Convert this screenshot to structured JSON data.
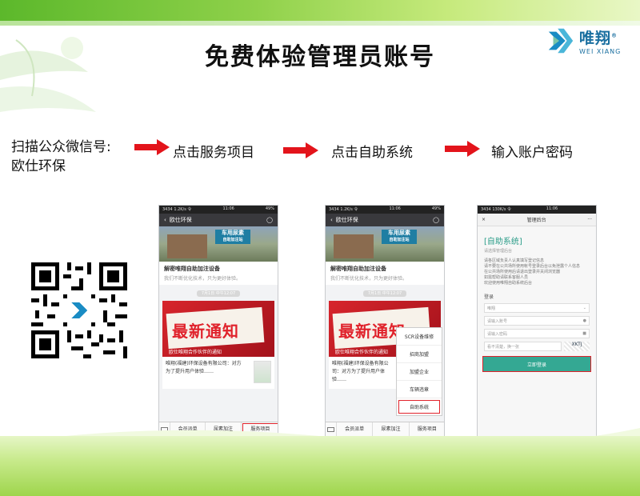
{
  "title": "免费体验管理员账号",
  "logo": {
    "cn": "唯翔",
    "reg": "®",
    "en": "WEI XIANG"
  },
  "steps": {
    "step1_line1": "扫描公众微信号:",
    "step1_line2": "欧仕环保",
    "step2": "点击服务项目",
    "step3": "点击自助系统",
    "step4": "输入账户密码"
  },
  "colors": {
    "arrow": "#e3141b",
    "green": "#5cb82b",
    "login_btn": "#34a893"
  },
  "phone1": {
    "status_left": "3434 1.2K/s 令",
    "status_time": "11:06",
    "status_right": "49%",
    "nav_title": "欧仕环保",
    "sign": "车用尿素",
    "sign_sub": "自助加注站",
    "article_title": "解密唯翔自助加注设备",
    "article_sub": "我们不断优化技术，只为更好体验。",
    "date": "7月1日 中午12:07",
    "notice_big": "最新通知",
    "notice_caption": "欧仕唯翔合作伙伴的通知",
    "notice_text": "唯翔(福建)环保设备有限公司：对方为了提升用户体验……",
    "menu": [
      "会员派单",
      "尿素加注",
      "服务项目"
    ]
  },
  "phone2": {
    "status_left": "3434 1.2K/s 令",
    "status_time": "11:06",
    "status_right": "49%",
    "nav_title": "欧仕环保",
    "sign": "车用尿素",
    "sign_sub": "自助加注站",
    "article_title": "解密唯翔自助加注设备",
    "article_sub": "我们不断优化技术，只为更好体验。",
    "date": "7月1日 中午12:07",
    "notice_big": "最新通知",
    "notice_caption": "欧仕唯翔合作伙伴的通知",
    "notice_text": "唯翔(福建)环保设备有限公司：对方为了提升用户体验……",
    "popup": [
      "SCR设备维修",
      "招商加盟",
      "加盟企业",
      "车辆违章",
      "自助系统"
    ],
    "menu": [
      "会员派单",
      "尿素加注",
      "服务项目"
    ]
  },
  "phone3": {
    "status_left": "3434 130K/s 令",
    "status_time": "11:06",
    "close": "×",
    "nav_title": "管理后台",
    "more": "···",
    "sys_title": "[自助系统]",
    "sys_sub": "请选择管理后台",
    "rules": [
      "请各区域负责人认真填写登记信息",
      "请不要在公共场所使用帐号登录后台以免泄露个人信息",
      "在公共场所使用后请退出登录并关闭浏览器",
      "如需帮助请联系客服人员",
      "欢迎使用唯翔自助系统后台"
    ],
    "section": "登录",
    "select_value": "唯翔",
    "username_placeholder": "请输入账号",
    "password_placeholder": "请输入密码",
    "captcha_placeholder": "看不清楚，换一张",
    "captcha_text": "XKTJ",
    "login_button": "立即登录"
  }
}
